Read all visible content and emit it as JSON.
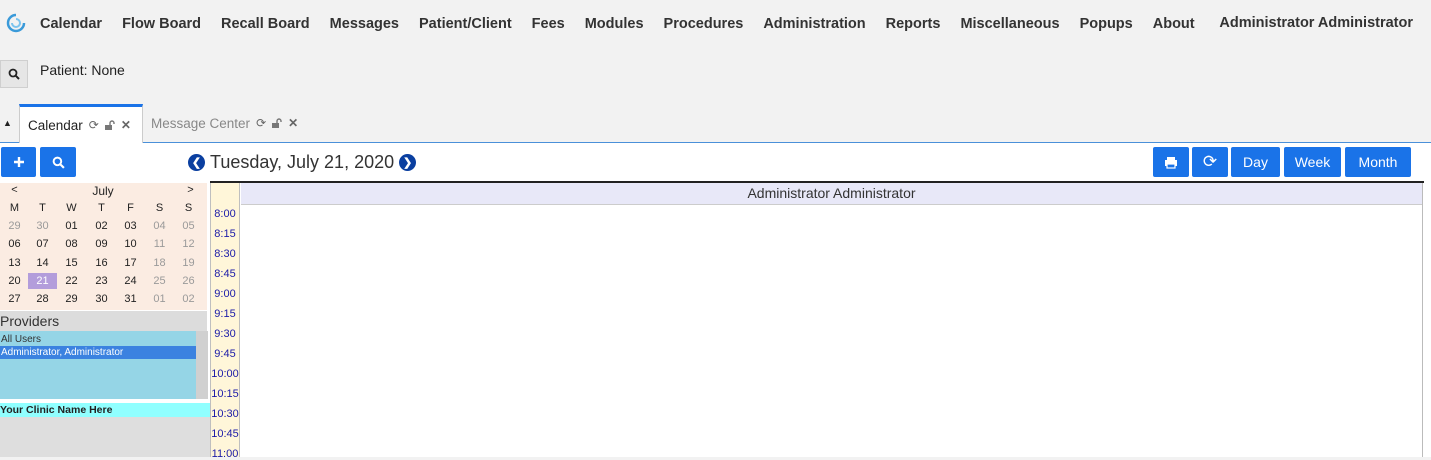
{
  "nav": {
    "menu": [
      "Calendar",
      "Flow Board",
      "Recall Board",
      "Messages",
      "Patient/Client",
      "Fees",
      "Modules",
      "Procedures",
      "Administration",
      "Reports",
      "Miscellaneous",
      "Popups",
      "About"
    ],
    "user": "Administrator Administrator"
  },
  "patient": {
    "label": "Patient: None"
  },
  "tabs": [
    {
      "label": "Calendar"
    },
    {
      "label": "Message Center"
    }
  ],
  "toolbar": {
    "date": "Tuesday, July 21, 2020",
    "view_buttons": [
      "Day",
      "Week",
      "Month"
    ]
  },
  "mini_calendar": {
    "prev": "<",
    "next": ">",
    "month": "July",
    "weekdays": [
      "M",
      "T",
      "W",
      "T",
      "F",
      "S",
      "S"
    ],
    "weeks": [
      [
        "29",
        "30",
        "01",
        "02",
        "03",
        "04",
        "05"
      ],
      [
        "06",
        "07",
        "08",
        "09",
        "10",
        "11",
        "12"
      ],
      [
        "13",
        "14",
        "15",
        "16",
        "17",
        "18",
        "19"
      ],
      [
        "20",
        "21",
        "22",
        "23",
        "24",
        "25",
        "26"
      ],
      [
        "27",
        "28",
        "29",
        "30",
        "31",
        "01",
        "02"
      ]
    ]
  },
  "providers": {
    "title": "Providers",
    "items": [
      "All Users",
      "Administrator, Administrator"
    ]
  },
  "clinic": "Your Clinic Name Here",
  "schedule": {
    "provider": "Administrator Administrator",
    "times": [
      "8:00",
      "8:15",
      "8:30",
      "8:45",
      "9:00",
      "9:15",
      "9:30",
      "9:45",
      "10:00",
      "10:15",
      "10:30",
      "10:45",
      "11:00"
    ]
  }
}
